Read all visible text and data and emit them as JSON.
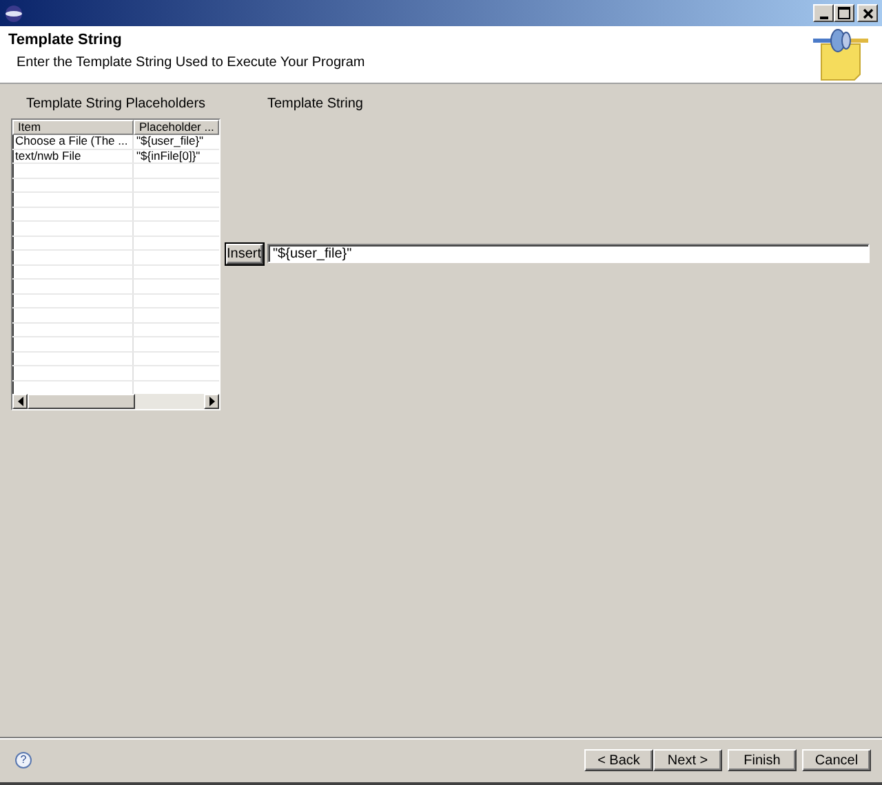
{
  "header": {
    "title": "Template String",
    "description": "Enter the Template String Used to Execute Your Program"
  },
  "placeholders": {
    "label": "Template String Placeholders",
    "columns": [
      "Item",
      "Placeholder ..."
    ],
    "rows": [
      {
        "item": "Choose a File (The ...",
        "placeholder": "\"${user_file}\""
      },
      {
        "item": "text/nwb File",
        "placeholder": "\"${inFile[0]}\""
      }
    ]
  },
  "insert_button": "Insert",
  "help": "?",
  "template_string": {
    "label": "Template String",
    "value": "\"${user_file}\""
  },
  "buttons": [
    {
      "label": "< Back"
    },
    {
      "label": "Next >"
    },
    {
      "label": "Finish"
    },
    {
      "label": "Cancel"
    }
  ]
}
